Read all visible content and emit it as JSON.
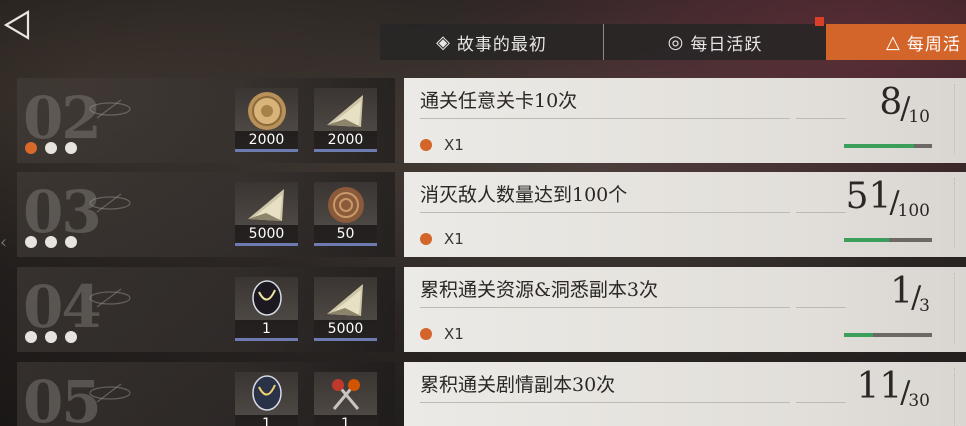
{
  "tabs": [
    {
      "label": "故事的最初",
      "icon": "diamond-target-icon"
    },
    {
      "label": "每日活跃",
      "icon": "circle-target-icon"
    },
    {
      "label": "每周活",
      "icon": "triangle-icon",
      "active": true
    }
  ],
  "colors": {
    "accent": "#d4652a",
    "progress": "#3b9e5a",
    "reward_bar": "#6e7bb0"
  },
  "tasks": [
    {
      "number": "02",
      "dots": 3,
      "dots_on": 1,
      "rewards": [
        {
          "icon": "gold-coin-icon",
          "qty": "2000"
        },
        {
          "icon": "crystal-shard-icon",
          "qty": "2000"
        }
      ],
      "title": "通关任意关卡10次",
      "reward": "X1",
      "current": "8",
      "total": "10",
      "progress": 0.8
    },
    {
      "number": "03",
      "dots": 3,
      "dots_on": 0,
      "rewards": [
        {
          "icon": "crystal-shard-icon",
          "qty": "5000"
        },
        {
          "icon": "ammonite-fossil-icon",
          "qty": "50"
        }
      ],
      "title": "消灭敌人数量达到100个",
      "reward": "X1",
      "current": "51",
      "total": "100",
      "progress": 0.51
    },
    {
      "number": "04",
      "dots": 3,
      "dots_on": 0,
      "rewards": [
        {
          "icon": "glowing-orb-icon",
          "qty": "1"
        },
        {
          "icon": "crystal-shard-icon",
          "qty": "5000"
        }
      ],
      "title": "累积通关资源&洞悉副本3次",
      "reward": "X1",
      "current": "1",
      "total": "3",
      "progress": 0.33
    },
    {
      "number": "05",
      "dots": 3,
      "dots_on": 0,
      "rewards": [
        {
          "icon": "glowing-orb-icon",
          "qty": "1"
        },
        {
          "icon": "gem-keys-icon",
          "qty": "1"
        }
      ],
      "title": "累积通关剧情副本30次",
      "reward": "",
      "current": "11",
      "total": "30",
      "progress": 0.37
    }
  ]
}
